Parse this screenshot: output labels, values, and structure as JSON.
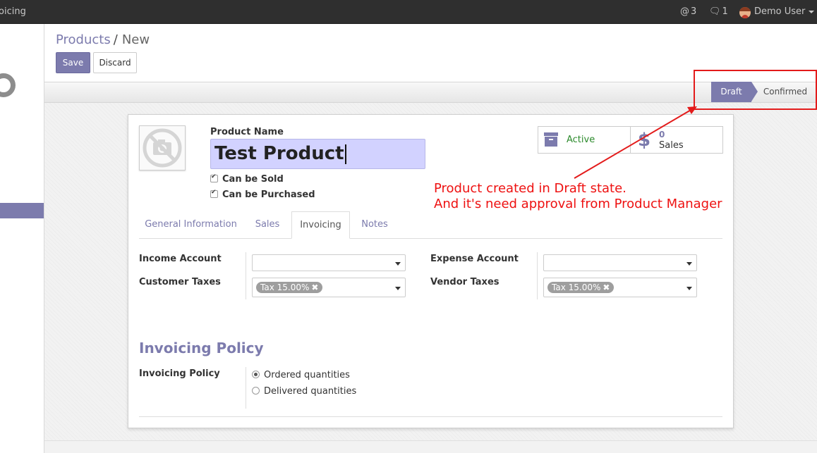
{
  "topbar": {
    "app_name": "oicing",
    "mentions_count": "3",
    "messages_count": "1",
    "user_name": "Demo User"
  },
  "breadcrumb": {
    "parent": "Products",
    "separator": "/",
    "current": "New"
  },
  "buttons": {
    "save": "Save",
    "discard": "Discard"
  },
  "statusbar": {
    "draft": "Draft",
    "confirmed": "Confirmed",
    "active_state": "Draft"
  },
  "product": {
    "name_label": "Product Name",
    "name_value": "Test Product",
    "can_be_sold": "Can be Sold",
    "can_be_purchased": "Can be Purchased"
  },
  "smart_buttons": {
    "active_label": "Active",
    "sales_count": "0",
    "sales_label": "Sales"
  },
  "tabs": [
    {
      "label": "General Information"
    },
    {
      "label": "Sales"
    },
    {
      "label": "Invoicing"
    },
    {
      "label": "Notes"
    }
  ],
  "active_tab": "Invoicing",
  "fields": {
    "income_account": {
      "label": "Income Account",
      "value": ""
    },
    "customer_taxes": {
      "label": "Customer Taxes",
      "tag": "Tax 15.00%"
    },
    "expense_account": {
      "label": "Expense Account",
      "value": ""
    },
    "vendor_taxes": {
      "label": "Vendor Taxes",
      "tag": "Tax 15.00%"
    }
  },
  "invoicing_policy": {
    "section_title": "Invoicing Policy",
    "label": "Invoicing Policy",
    "options": [
      "Ordered quantities",
      "Delivered quantities"
    ],
    "selected": "Ordered quantities"
  },
  "annotation": {
    "line1": "Product created in Draft state.",
    "line2": "And it's need approval from Product Manager"
  },
  "colors": {
    "brand": "#7c7bad",
    "annotation_red": "#e31b1b",
    "active_green": "#2c8a2c",
    "name_input_bg": "#d2d2ff"
  }
}
